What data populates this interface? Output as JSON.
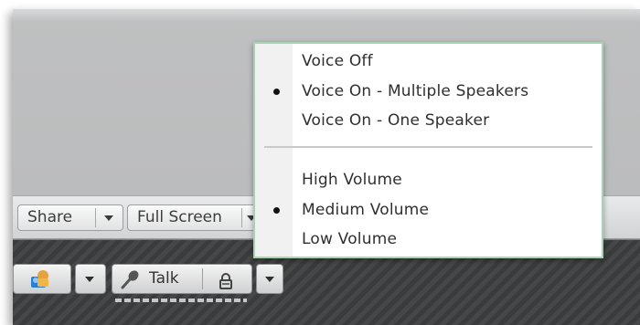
{
  "toolbar": {
    "share_label": "Share",
    "fullscreen_label": "Full Screen"
  },
  "audio_bar": {
    "talk_label": "Talk",
    "icons": [
      "webcam-icon",
      "microphone-icon",
      "lock-icon",
      "chevron-down-icon"
    ]
  },
  "menu": {
    "voice_items": [
      {
        "label": "Voice Off",
        "selected": false
      },
      {
        "label": "Voice On - Multiple Speakers",
        "selected": true
      },
      {
        "label": "Voice On - One Speaker",
        "selected": false
      }
    ],
    "volume_items": [
      {
        "label": "High Volume",
        "selected": false
      },
      {
        "label": "Medium Volume",
        "selected": true
      },
      {
        "label": "Low Volume",
        "selected": false
      }
    ]
  },
  "colors": {
    "menu_border": "#a7d3b2",
    "dark_bar": "#3c3d3e"
  }
}
